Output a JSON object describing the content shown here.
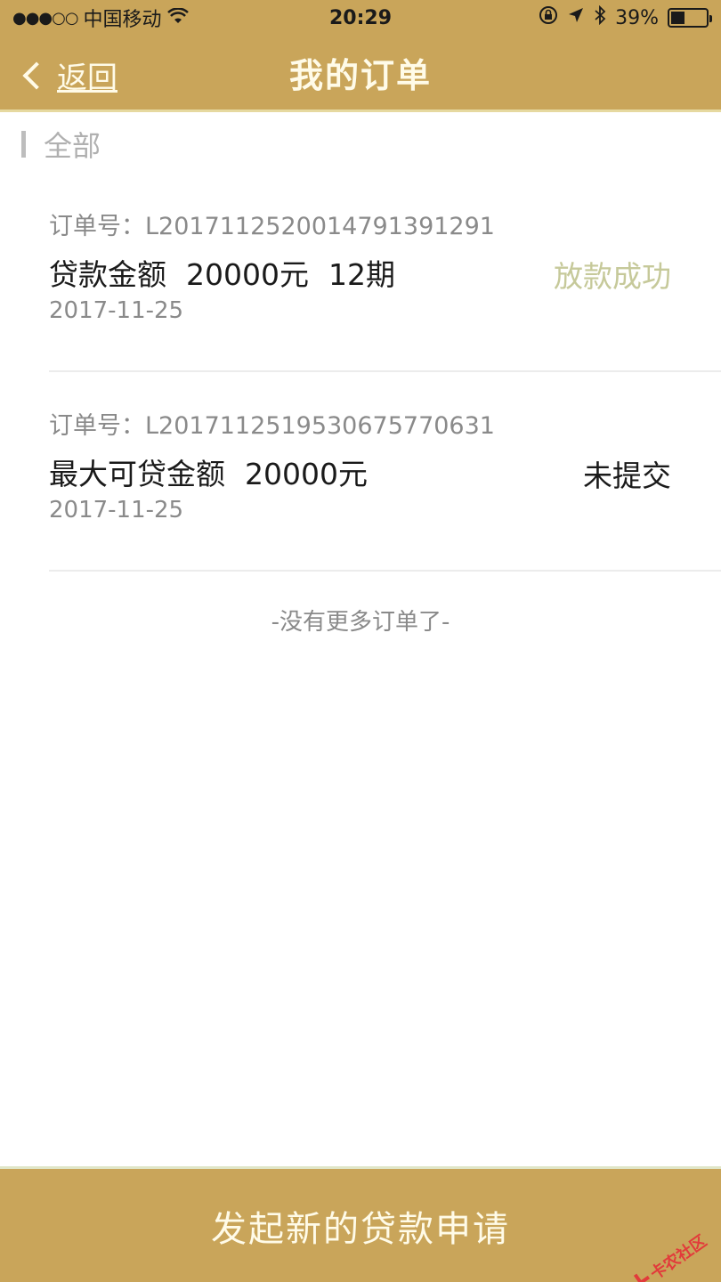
{
  "status_bar": {
    "signal": "●●●○○",
    "carrier": "中国移动",
    "wifi_icon": "wifi-icon",
    "time": "20:29",
    "battery_percent": "39%",
    "battery_level": 0.39
  },
  "nav": {
    "back_label": "返回",
    "title": "我的订单"
  },
  "filter": {
    "label": "全部"
  },
  "orders": [
    {
      "order_no": "订单号：L2017112520014791391291",
      "main_parts": [
        "贷款金额",
        "20000元",
        "12期"
      ],
      "date": "2017-11-25",
      "status": "放款成功"
    },
    {
      "order_no": "订单号：L2017112519530675770631",
      "main_parts": [
        "最大可贷金额",
        "20000元"
      ],
      "date": "2017-11-25",
      "status": "未提交"
    }
  ],
  "no_more_text": "-没有更多订单了-",
  "bottom_button": {
    "label": "发起新的贷款申请"
  },
  "watermark": {
    "text": "卡农社区"
  },
  "colors": {
    "header_gold": "#c9a55a",
    "success_status": "#c6c99a"
  }
}
